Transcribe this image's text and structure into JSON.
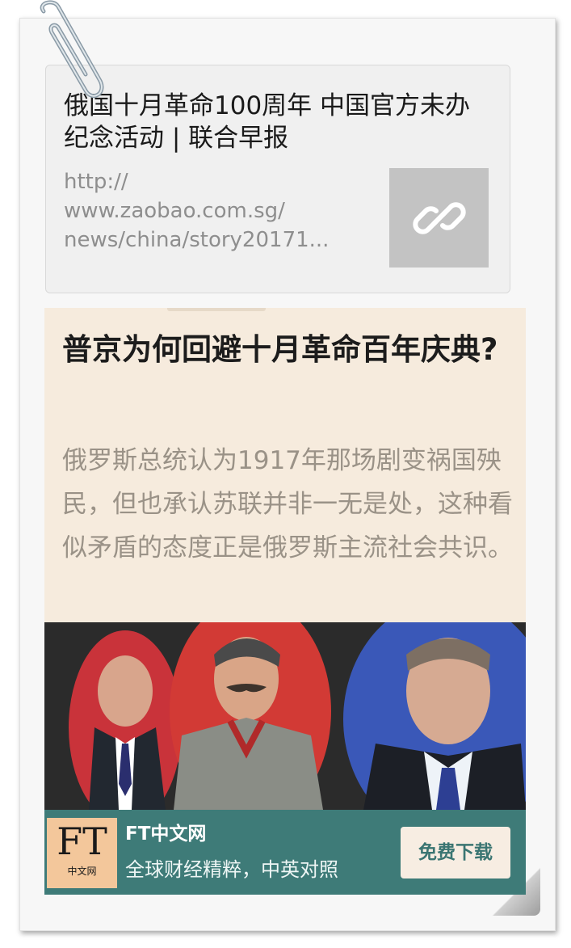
{
  "link_card": {
    "title": "俄国十月革命100周年 中国官方未办纪念活动 | 联合早报",
    "url": "http://\nwww.zaobao.com.sg/\nnews/china/story20171...",
    "thumb_icon": "link-icon"
  },
  "article": {
    "title": "普京为何回避十月革命百年庆典?",
    "description": "俄罗斯总统认为1917年那场剧变祸国殃民，但也承认苏联并非一无是处，这种看似矛盾的态度正是俄罗斯主流社会共识。"
  },
  "ad": {
    "logo_text": "FT",
    "logo_subtext": "中文网",
    "title": "FT中文网",
    "subtitle": "全球财经精粹，中英对照",
    "button_label": "免费下载",
    "colors": {
      "bar": "#3e7b78",
      "logo_bg": "#f3c79b",
      "button_bg": "#f7ede2"
    }
  }
}
